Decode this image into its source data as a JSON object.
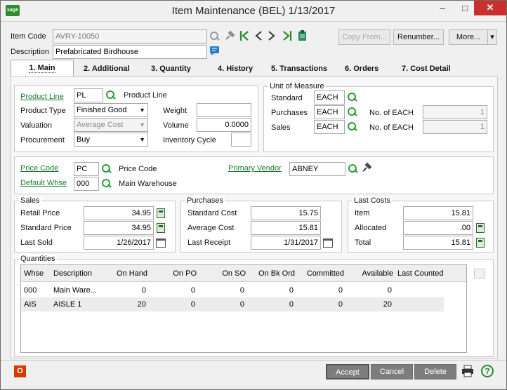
{
  "window": {
    "title": "Item Maintenance (BEL) 1/13/2017",
    "logo_text": "sage",
    "minimize": "–",
    "maximize": "□",
    "close": "✕"
  },
  "header": {
    "item_code_label": "Item Code",
    "item_code_value": "AVRY-10050",
    "description_label": "Description",
    "description_value": "Prefabricated Birdhouse",
    "copy_from_label": "Copy From...",
    "renumber_label": "Renumber...",
    "more_label": "More...",
    "more_arrow": "▾"
  },
  "tabs": [
    {
      "label": "1. Main"
    },
    {
      "label": "2. Additional"
    },
    {
      "label": "3. Quantity"
    },
    {
      "label": "4. History"
    },
    {
      "label": "5. Transactions"
    },
    {
      "label": "6. Orders"
    },
    {
      "label": "7. Cost Detail"
    }
  ],
  "general": {
    "product_line_label": "Product Line",
    "product_line_value": "PL",
    "product_line_desc": "Product Line",
    "product_type_label": "Product Type",
    "product_type_value": "Finished Good",
    "valuation_label": "Valuation",
    "valuation_value": "Average Cost",
    "procurement_label": "Procurement",
    "procurement_value": "Buy",
    "weight_label": "Weight",
    "weight_value": "",
    "volume_label": "Volume",
    "volume_value": "0.0000",
    "inventory_cycle_label": "Inventory Cycle",
    "inventory_cycle_value": ""
  },
  "uom": {
    "title": "Unit of Measure",
    "standard_label": "Standard",
    "standard_value": "EACH",
    "purchases_label": "Purchases",
    "purchases_value": "EACH",
    "purchases_no_of_label": "No. of  EACH",
    "purchases_no_of_value": "1",
    "sales_label": "Sales",
    "sales_value": "EACH",
    "sales_no_of_label": "No. of  EACH",
    "sales_no_of_value": "1"
  },
  "codes": {
    "price_code_label": "Price Code",
    "price_code_value": "PC",
    "price_code_desc": "Price Code",
    "default_whse_label": "Default Whse",
    "default_whse_value": "000",
    "default_whse_desc": "Main Warehouse",
    "primary_vendor_label": "Primary Vendor",
    "primary_vendor_value": "ABNEY"
  },
  "sales": {
    "title": "Sales",
    "retail_price_label": "Retail Price",
    "retail_price_value": "34.95",
    "standard_price_label": "Standard Price",
    "standard_price_value": "34.95",
    "last_sold_label": "Last Sold",
    "last_sold_value": "1/26/2017"
  },
  "purchases": {
    "title": "Purchases",
    "standard_cost_label": "Standard Cost",
    "standard_cost_value": "15.75",
    "average_cost_label": "Average Cost",
    "average_cost_value": "15.81",
    "last_receipt_label": "Last Receipt",
    "last_receipt_value": "1/31/2017"
  },
  "last_costs": {
    "title": "Last Costs",
    "item_label": "Item",
    "item_value": "15.81",
    "allocated_label": "Allocated",
    "allocated_value": ".00",
    "total_label": "Total",
    "total_value": "15.81"
  },
  "quantities": {
    "title": "Quantities",
    "columns": [
      "Whse",
      "Description",
      "On Hand",
      "On PO",
      "On SO",
      "On Bk Ord",
      "Committed",
      "Available",
      "Last Counted"
    ],
    "rows": [
      [
        "000",
        "Main Ware...",
        "0",
        "0",
        "0",
        "0",
        "0",
        "0",
        ""
      ],
      [
        "AIS",
        "AISLE 1",
        "20",
        "0",
        "0",
        "0",
        "0",
        "20",
        ""
      ]
    ]
  },
  "footer": {
    "office_icon_text": "O",
    "accept_label": "Accept",
    "cancel_label": "Cancel",
    "delete_label": "Delete",
    "help_text": "?"
  }
}
